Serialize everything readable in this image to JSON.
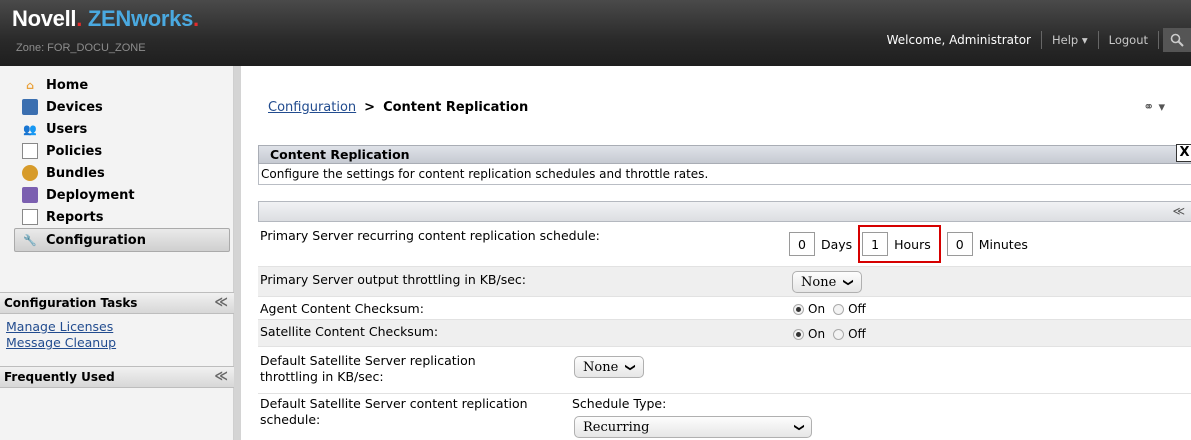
{
  "header": {
    "brand_novell": "Novell",
    "brand_dot": ".",
    "brand_zenworks": "ZENworks",
    "brand_trail": ".",
    "zone": "Zone: FOR_DOCU_ZONE",
    "welcome": "Welcome, Administrator",
    "help": "Help",
    "help_caret": "▾",
    "logout": "Logout"
  },
  "sidebar": {
    "nav": [
      {
        "label": "Home"
      },
      {
        "label": "Devices"
      },
      {
        "label": "Users"
      },
      {
        "label": "Policies"
      },
      {
        "label": "Bundles"
      },
      {
        "label": "Deployment"
      },
      {
        "label": "Reports"
      },
      {
        "label": "Configuration"
      }
    ],
    "tasks_title": "Configuration Tasks",
    "tasks": [
      "Manage Licenses",
      "Message Cleanup"
    ],
    "frequent_title": "Frequently Used"
  },
  "breadcrumb": {
    "parent": "Configuration",
    "separator": ">",
    "current": "Content Replication"
  },
  "panel": {
    "title": "Content Replication",
    "close": "X",
    "description": "Configure the settings for content replication schedules and throttle rates."
  },
  "settings": {
    "primary_schedule": {
      "label": "Primary Server recurring content replication schedule:",
      "days_value": "0",
      "days_unit": "Days",
      "hours_value": "1",
      "hours_unit": "Hours",
      "minutes_value": "0",
      "minutes_unit": "Minutes"
    },
    "primary_throttle": {
      "label": "Primary Server output throttling in KB/sec:",
      "value": "None"
    },
    "agent_checksum": {
      "label": "Agent Content Checksum:",
      "on": "On",
      "off": "Off"
    },
    "satellite_checksum": {
      "label": "Satellite Content Checksum:",
      "on": "On",
      "off": "Off"
    },
    "satellite_throttle": {
      "label_line1": "Default Satellite Server replication",
      "label_line2": "throttling in KB/sec:",
      "value": "None"
    },
    "satellite_schedule": {
      "label_line1": "Default Satellite Server content replication",
      "label_line2": "schedule:",
      "type_label": "Schedule Type:",
      "value": "Recurring"
    }
  },
  "colors": {
    "accent_blue": "#4aa9e0",
    "novell_red": "#e42c2c",
    "highlight_red": "#d60000",
    "link_blue": "#224c8f"
  }
}
